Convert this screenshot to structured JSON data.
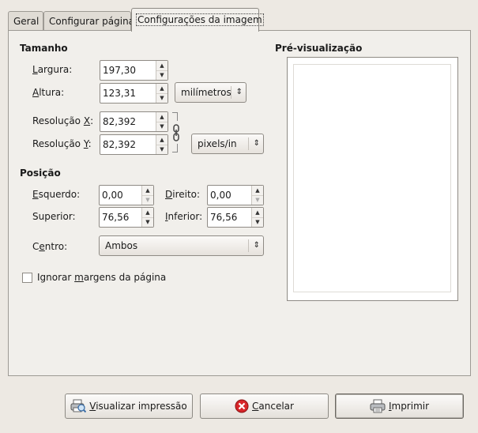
{
  "tabs": [
    {
      "label": "Geral"
    },
    {
      "label": "Configurar página"
    },
    {
      "label": "Configurações da imagem"
    }
  ],
  "size": {
    "heading": "Tamanho",
    "width_label_ul": "L",
    "width_label_rest": "argura:",
    "width_value": "197,30",
    "height_label_ul": "A",
    "height_label_rest": "ltura:",
    "height_value": "123,31",
    "unit": "milímetros",
    "res_x_label_pre": "Resolução ",
    "res_x_label_ul": "X",
    "res_x_label_post": ":",
    "res_x_value": "82,392",
    "res_y_label_pre": "Resolução ",
    "res_y_label_ul": "Y",
    "res_y_label_post": ":",
    "res_y_value": "82,392",
    "res_unit": "pixels/in"
  },
  "position": {
    "heading": "Posição",
    "left_label_ul": "E",
    "left_label_rest": "squerdo:",
    "left_value": "0,00",
    "right_label_ul": "D",
    "right_label_rest": "ireito:",
    "right_value": "0,00",
    "top_label": "Superior:",
    "top_value": "76,56",
    "bottom_label_ul": "I",
    "bottom_label_rest": "nferior:",
    "bottom_value": "76,56",
    "center_label_pre": "C",
    "center_label_ul": "e",
    "center_label_rest": "ntro:",
    "center_value": "Ambos"
  },
  "ignore_margins": {
    "label_pre": "Ignorar ",
    "label_ul": "m",
    "label_rest": "argens da página"
  },
  "preview": {
    "heading": "Pré-visualização"
  },
  "buttons": {
    "print_preview_ul": "V",
    "print_preview_rest": "isualizar impressão",
    "cancel_ul": "C",
    "cancel_rest": "ancelar",
    "print_ul": "I",
    "print_rest": "mprimir"
  },
  "icons": [
    "print-preview-icon",
    "cancel-icon",
    "printer-icon",
    "chain-link-icon"
  ]
}
